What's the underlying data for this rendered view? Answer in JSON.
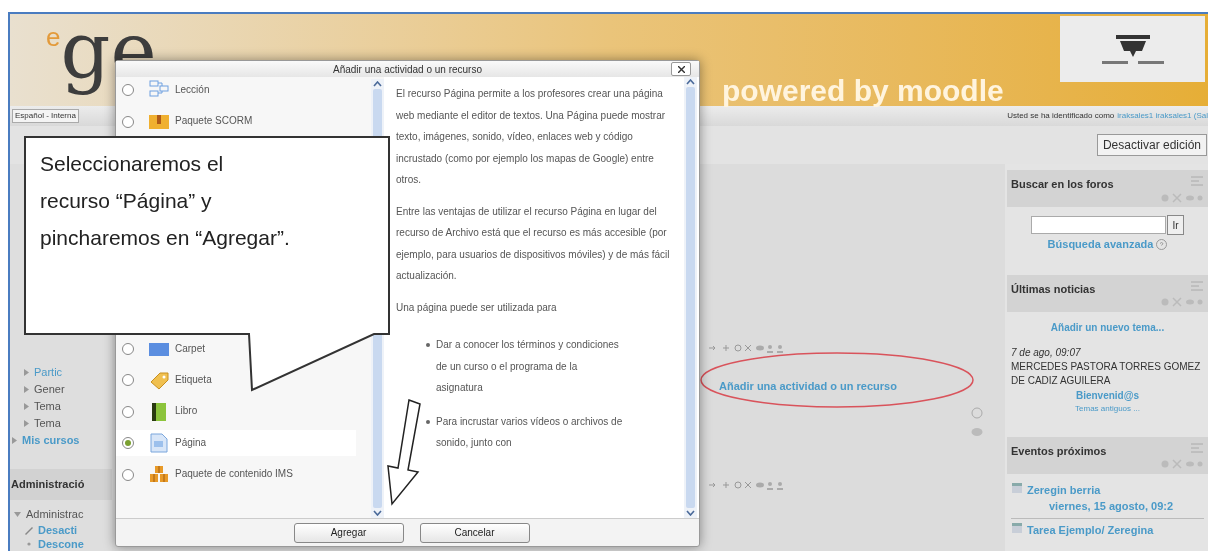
{
  "header": {
    "logo_mark": "e",
    "logo_text": "ge",
    "tagline": "powered by moodle"
  },
  "login_bar": {
    "language": "Español - Interna",
    "login_prefix": "Usted se ha identificado como",
    "login_link": "iraksales1 iraksales1 (Sal"
  },
  "edit_button": "Desactivar edición",
  "navigation": {
    "items": [
      {
        "label": "Partic",
        "kind": "link"
      },
      {
        "label": "Gener",
        "kind": "plain"
      },
      {
        "label": "Tema",
        "kind": "plain"
      },
      {
        "label": "Tema",
        "kind": "plain"
      }
    ],
    "my_courses": "Mis cursos"
  },
  "administration": {
    "title": "Administració",
    "items": [
      {
        "label": "Administrac",
        "expanded": true,
        "children": [
          {
            "label": "Desacti",
            "kind": "edit"
          },
          {
            "label": "Descone",
            "kind": "bullet"
          }
        ]
      }
    ]
  },
  "section": {
    "add_link": "Añadir una actividad o un recurso",
    "highlighted": true
  },
  "blocks": [
    {
      "kind": "search",
      "title": "Buscar en los foros",
      "button": "Ir",
      "link": "Búsqueda avanzada"
    },
    {
      "kind": "news",
      "title": "Últimas noticias",
      "add_link": "Añadir un nuevo tema...",
      "date": "7 de ago, 09:07",
      "author": "MERCEDES PASTORA TORRES GOMEZ DE CADIZ AGUILERA",
      "post": "Bienvenid@s",
      "older": "Temas antiguos ..."
    },
    {
      "kind": "events",
      "title": "Eventos próximos",
      "events": [
        {
          "name": "Zeregin berria",
          "when": "viernes, 15 agosto, 09:2"
        },
        {
          "name": "Tarea Ejemplo/ Zeregina"
        }
      ]
    }
  ],
  "dialog": {
    "title": "Añadir una actividad o un recurso",
    "items": [
      {
        "label": "Lección",
        "kind": "lesson",
        "selected": false
      },
      {
        "label": "Paquete SCORM",
        "kind": "scorm",
        "selected": false
      },
      {
        "label": "Carpet",
        "kind": "folder",
        "selected": false
      },
      {
        "label": "Etiqueta",
        "kind": "label",
        "selected": false
      },
      {
        "label": "Libro",
        "kind": "book",
        "selected": false
      },
      {
        "label": "Página",
        "kind": "page",
        "selected": true
      },
      {
        "label": "Paquete de contenido IMS",
        "kind": "package",
        "selected": false
      }
    ],
    "paragraphs": [
      "El recurso Página permite a los profesores crear una página web mediante el editor de textos. Una Página puede mostrar texto, imágenes, sonido, vídeo, enlaces web y código incrustado (como por ejemplo los mapas de Google) entre otros.",
      "Entre las ventajas de utilizar el recurso Página en lugar del recurso de Archivo está que el recurso es más accesible (por ejemplo, para usuarios de dispositivos móviles) y de más fácil actualización.",
      "Una página puede ser utilizada para"
    ],
    "bullets": [
      "Dar a conocer los términos y condiciones de un curso o el programa de la asignatura",
      "Para incrustar varios vídeos o archivos de sonido, junto con"
    ],
    "buttons": [
      "Agregar",
      "Cancelar"
    ]
  },
  "callout": {
    "text": "Seleccionaremos el recurso “Página” y pincharemos en “Agregar”."
  }
}
